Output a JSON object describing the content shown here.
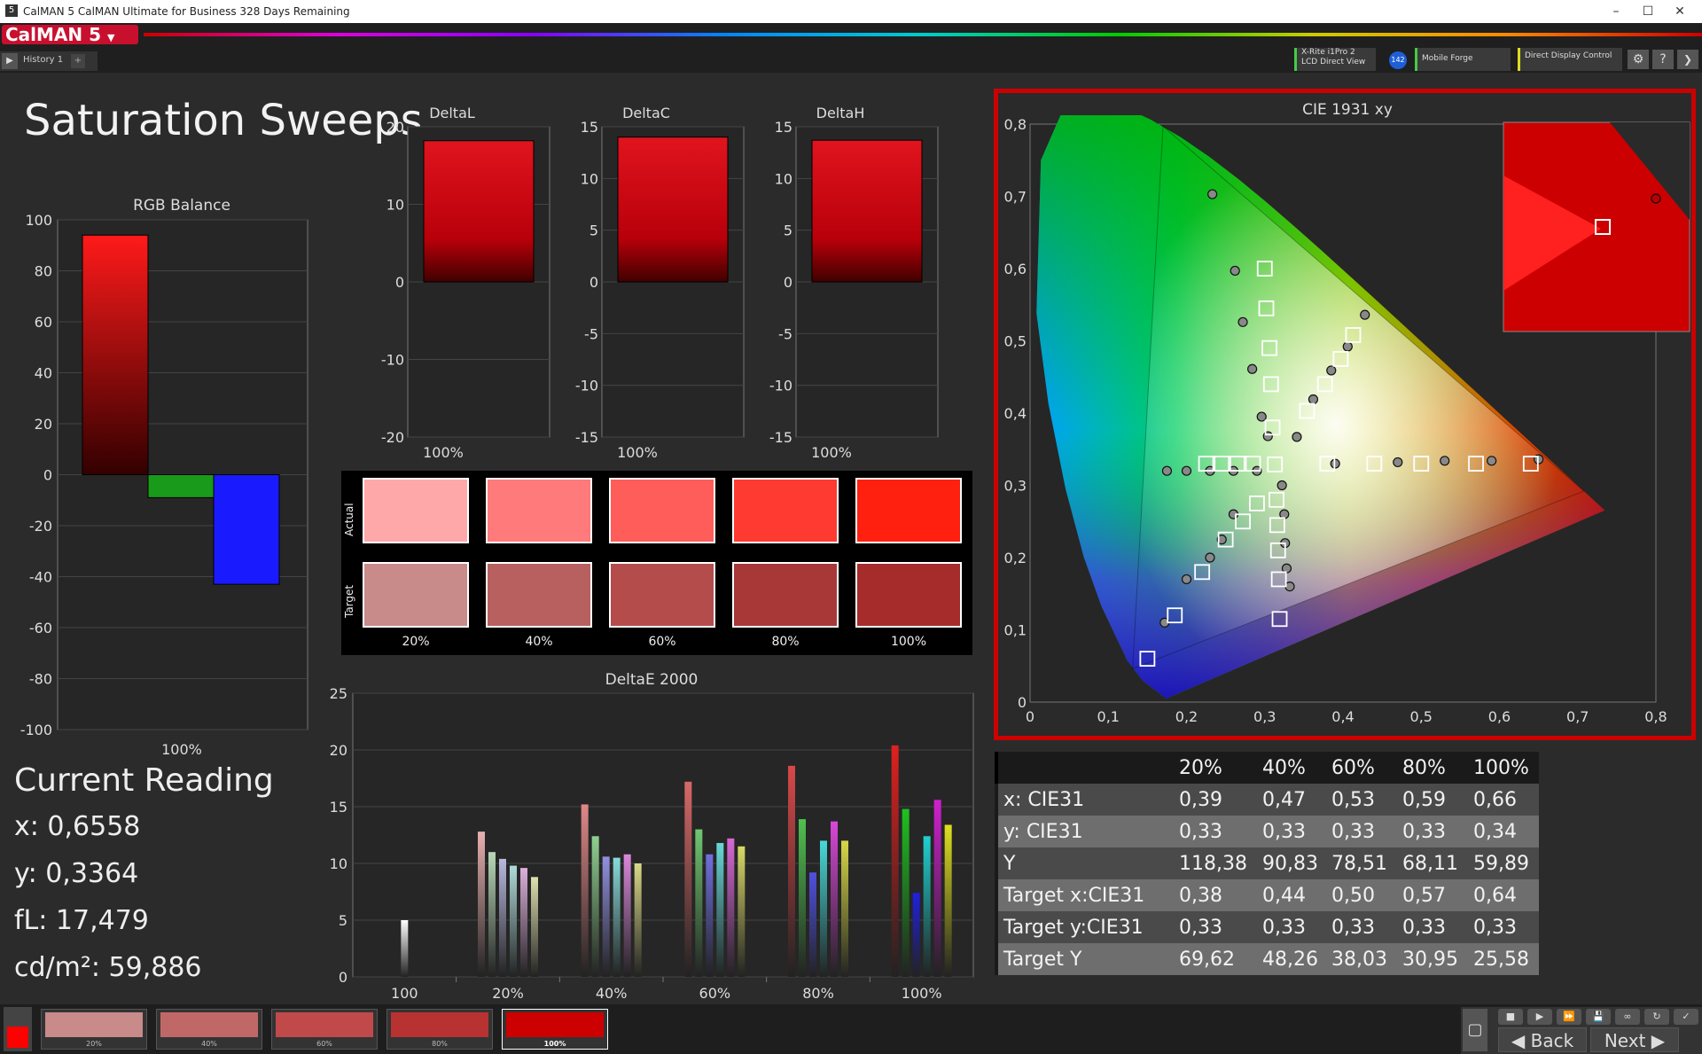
{
  "window": {
    "title": "CalMAN 5 CalMAN Ultimate for Business 328 Days Remaining",
    "logo": "5"
  },
  "app": {
    "brand": "CalMAN 5",
    "history_tab": "History 1"
  },
  "devices": [
    {
      "line1": "X-Rite i1Pro 2",
      "line2": "LCD Direct View",
      "color": "#44cc44"
    },
    {
      "line1": "Mobile Forge",
      "line2": "",
      "color": "#44cc44"
    },
    {
      "line1": "Direct Display Control",
      "line2": "",
      "color": "#dddd22"
    }
  ],
  "device_badge": "142",
  "page_title": "Saturation Sweeps",
  "rgb_balance": {
    "title": "RGB Balance",
    "ylim": [
      -100,
      100
    ],
    "ticks": [
      "100",
      "80",
      "60",
      "40",
      "20",
      "0",
      "-20",
      "-40",
      "-60",
      "-80",
      "-100"
    ],
    "xlabel": "100%",
    "bars": [
      {
        "name": "red",
        "value": 94,
        "color": "#ff1a1a"
      },
      {
        "name": "green",
        "value": -9,
        "color": "#1a9a1a"
      },
      {
        "name": "blue",
        "value": -43,
        "color": "#1a1aff"
      }
    ]
  },
  "delta_charts": [
    {
      "title": "DeltaL",
      "ylim": [
        -20,
        20
      ],
      "ticks": [
        "20",
        "10",
        "0",
        "-10",
        "-20"
      ],
      "value": 18.2,
      "xlabel": "100%"
    },
    {
      "title": "DeltaC",
      "ylim": [
        -15,
        15
      ],
      "ticks": [
        "15",
        "10",
        "5",
        "0",
        "-5",
        "-10",
        "-15"
      ],
      "value": 14,
      "xlabel": "100%"
    },
    {
      "title": "DeltaH",
      "ylim": [
        -15,
        15
      ],
      "ticks": [
        "15",
        "10",
        "5",
        "0",
        "-5",
        "-10",
        "-15"
      ],
      "value": 13.7,
      "xlabel": "100%"
    }
  ],
  "swatches": {
    "actual_label": "Actual",
    "target_label": "Target",
    "labels": [
      "20%",
      "40%",
      "60%",
      "80%",
      "100%"
    ],
    "actual": [
      "#ffa8aa",
      "#ff7a7a",
      "#ff5d5a",
      "#ff3a30",
      "#ff2010"
    ],
    "target": [
      "#c98a8a",
      "#b86060",
      "#b44c4c",
      "#a83838",
      "#a62c2c"
    ]
  },
  "deltae": {
    "title": "DeltaE 2000",
    "ylim": [
      0,
      25
    ],
    "ticks": [
      "25",
      "20",
      "15",
      "10",
      "5",
      "0"
    ],
    "categories": [
      "100",
      "20%",
      "40%",
      "60%",
      "80%",
      "100%"
    ],
    "series_colors": [
      "#d66",
      "#6c6",
      "#66d",
      "#6dd",
      "#d6d",
      "#dd6"
    ],
    "groups": [
      {
        "label": "100",
        "values": [
          5.0
        ],
        "colors": [
          "#ffffff"
        ]
      },
      {
        "label": "20%",
        "values": [
          12.8,
          11.0,
          10.4,
          9.8,
          9.6,
          8.8
        ],
        "colors": [
          "#e8b0b0",
          "#b8d8b8",
          "#b8b8e0",
          "#b0dada",
          "#dcb0dc",
          "#e0e0b0"
        ]
      },
      {
        "label": "40%",
        "values": [
          15.2,
          12.4,
          10.6,
          10.5,
          10.8,
          10.0
        ],
        "colors": [
          "#e08888",
          "#90d090",
          "#9090e0",
          "#88dada",
          "#da88da",
          "#dada88"
        ]
      },
      {
        "label": "60%",
        "values": [
          17.2,
          13.0,
          10.8,
          11.8,
          12.2,
          11.5
        ],
        "colors": [
          "#d86868",
          "#70c870",
          "#7070e0",
          "#68d8d8",
          "#d868d8",
          "#d8d868"
        ]
      },
      {
        "label": "80%",
        "values": [
          18.6,
          13.9,
          9.2,
          12.0,
          13.7,
          12.0
        ],
        "colors": [
          "#d84848",
          "#50c050",
          "#5050e0",
          "#48d8d8",
          "#d848d8",
          "#d8d848"
        ]
      },
      {
        "label": "100%",
        "values": [
          20.4,
          14.8,
          7.4,
          12.4,
          15.6,
          13.4
        ],
        "colors": [
          "#e02020",
          "#20c020",
          "#2020e0",
          "#20d0d0",
          "#d020d0",
          "#e0e020"
        ]
      }
    ]
  },
  "cie": {
    "title": "CIE 1931 xy",
    "xlim": [
      0,
      0.8
    ],
    "ylim": [
      0,
      0.8
    ],
    "xticks": [
      "0",
      "0,1",
      "0,2",
      "0,3",
      "0,4",
      "0,5",
      "0,6",
      "0,7",
      "0,8"
    ],
    "yticks": [
      "0",
      "0,1",
      "0,2",
      "0,3",
      "0,4",
      "0,5",
      "0,6",
      "0,7",
      "0,8"
    ],
    "gamut": [
      [
        0.708,
        0.292
      ],
      [
        0.17,
        0.797
      ],
      [
        0.131,
        0.046
      ]
    ],
    "targets": [
      [
        0.3,
        0.6
      ],
      [
        0.302,
        0.545
      ],
      [
        0.306,
        0.49
      ],
      [
        0.308,
        0.44
      ],
      [
        0.31,
        0.38
      ],
      [
        0.313,
        0.329
      ],
      [
        0.413,
        0.508
      ],
      [
        0.397,
        0.475
      ],
      [
        0.377,
        0.44
      ],
      [
        0.354,
        0.403
      ],
      [
        0.38,
        0.33
      ],
      [
        0.44,
        0.33
      ],
      [
        0.5,
        0.33
      ],
      [
        0.57,
        0.33
      ],
      [
        0.64,
        0.33
      ],
      [
        0.225,
        0.33
      ],
      [
        0.245,
        0.33
      ],
      [
        0.265,
        0.33
      ],
      [
        0.285,
        0.33
      ],
      [
        0.29,
        0.275
      ],
      [
        0.272,
        0.25
      ],
      [
        0.25,
        0.225
      ],
      [
        0.22,
        0.18
      ],
      [
        0.185,
        0.12
      ],
      [
        0.15,
        0.06
      ],
      [
        0.315,
        0.28
      ],
      [
        0.316,
        0.245
      ],
      [
        0.317,
        0.21
      ],
      [
        0.318,
        0.17
      ],
      [
        0.319,
        0.115
      ]
    ],
    "measured": [
      [
        0.233,
        0.703
      ],
      [
        0.262,
        0.597
      ],
      [
        0.272,
        0.526
      ],
      [
        0.284,
        0.461
      ],
      [
        0.296,
        0.395
      ],
      [
        0.304,
        0.368
      ],
      [
        0.428,
        0.536
      ],
      [
        0.406,
        0.492
      ],
      [
        0.385,
        0.459
      ],
      [
        0.362,
        0.419
      ],
      [
        0.341,
        0.367
      ],
      [
        0.39,
        0.33
      ],
      [
        0.47,
        0.332
      ],
      [
        0.53,
        0.334
      ],
      [
        0.59,
        0.334
      ],
      [
        0.65,
        0.336
      ],
      [
        0.175,
        0.32
      ],
      [
        0.2,
        0.32
      ],
      [
        0.23,
        0.32
      ],
      [
        0.26,
        0.32
      ],
      [
        0.29,
        0.32
      ],
      [
        0.26,
        0.26
      ],
      [
        0.245,
        0.225
      ],
      [
        0.23,
        0.2
      ],
      [
        0.2,
        0.17
      ],
      [
        0.172,
        0.11
      ],
      [
        0.322,
        0.3
      ],
      [
        0.325,
        0.26
      ],
      [
        0.326,
        0.22
      ],
      [
        0.328,
        0.185
      ],
      [
        0.332,
        0.16
      ]
    ],
    "inset_point_target": [
      0.64,
      0.33
    ],
    "inset_point_measured": [
      0.656,
      0.336
    ]
  },
  "current_reading": {
    "title": "Current Reading",
    "x": "x: 0,6558",
    "y": "y: 0,3364",
    "fl": "fL: 17,479",
    "cdm2": "cd/m²: 59,886"
  },
  "table": {
    "headers": [
      "20%",
      "40%",
      "60%",
      "80%",
      "100%"
    ],
    "rows": [
      {
        "label": "x: CIE31",
        "values": [
          "0,39",
          "0,47",
          "0,53",
          "0,59",
          "0,66"
        ]
      },
      {
        "label": "y: CIE31",
        "values": [
          "0,33",
          "0,33",
          "0,33",
          "0,33",
          "0,34"
        ]
      },
      {
        "label": "Y",
        "values": [
          "118,38",
          "90,83",
          "78,51",
          "68,11",
          "59,89"
        ]
      },
      {
        "label": "Target x:CIE31",
        "values": [
          "0,38",
          "0,44",
          "0,50",
          "0,57",
          "0,64"
        ]
      },
      {
        "label": "Target y:CIE31",
        "values": [
          "0,33",
          "0,33",
          "0,33",
          "0,33",
          "0,33"
        ]
      },
      {
        "label": "Target Y",
        "values": [
          "69,62",
          "48,26",
          "38,03",
          "30,95",
          "25,58"
        ]
      }
    ]
  },
  "bottom": {
    "swatches": [
      {
        "label": "20%",
        "color": "#c98a8a"
      },
      {
        "label": "40%",
        "color": "#c06868"
      },
      {
        "label": "60%",
        "color": "#c04a4a"
      },
      {
        "label": "80%",
        "color": "#b83232"
      },
      {
        "label": "100%",
        "color": "#cc0000"
      }
    ],
    "back": "Back",
    "next": "Next"
  }
}
